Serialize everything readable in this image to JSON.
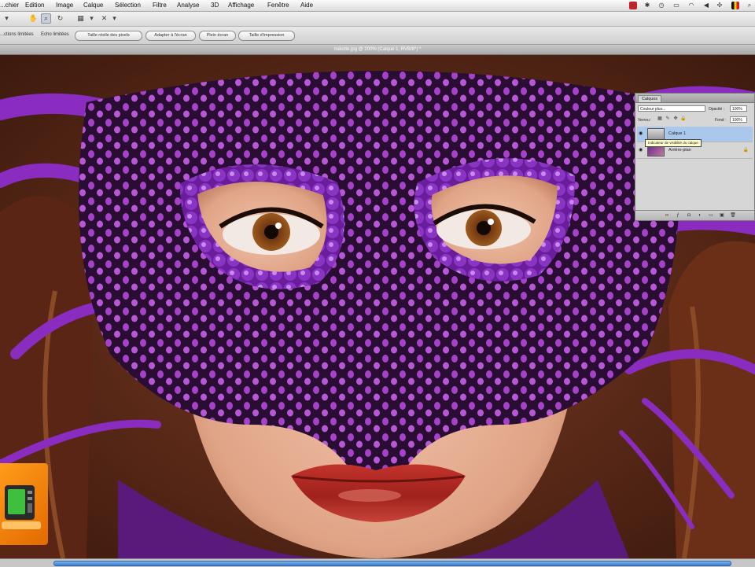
{
  "menu": {
    "items": [
      "...chier",
      "Edition",
      "Image",
      "Calque",
      "Sélection",
      "Filtre",
      "Analyse",
      "3D",
      "Affichage",
      "Fenêtre",
      "Aide"
    ]
  },
  "options_bar": {
    "label_1": "...ctions limitées",
    "label_2": "Echo limitées",
    "buttons": [
      "Taille réelle des pixels",
      "Adapter à l'écran",
      "Plein écran",
      "Taille d'impression"
    ]
  },
  "document": {
    "tab_title": "mélotte.jpg @ 200% (Calque 1, RVB/8*) *"
  },
  "layers_panel": {
    "tab_label": "Calques",
    "blend_mode": "Couleur plus...",
    "opacity_label": "Opacité :",
    "opacity_value": "100%",
    "lock_label": "Verrou :",
    "fill_label": "Fond :",
    "fill_value": "100%",
    "layers": [
      {
        "name": "Calque 1",
        "selected": true
      },
      {
        "name": "Arrière-plan",
        "selected": false
      }
    ],
    "tooltip": "Indicateur de visibilité du calque"
  },
  "colors": {
    "accent": "#3c7fd0",
    "selection": "#a9c8ec",
    "logo": "#f28a0c"
  }
}
